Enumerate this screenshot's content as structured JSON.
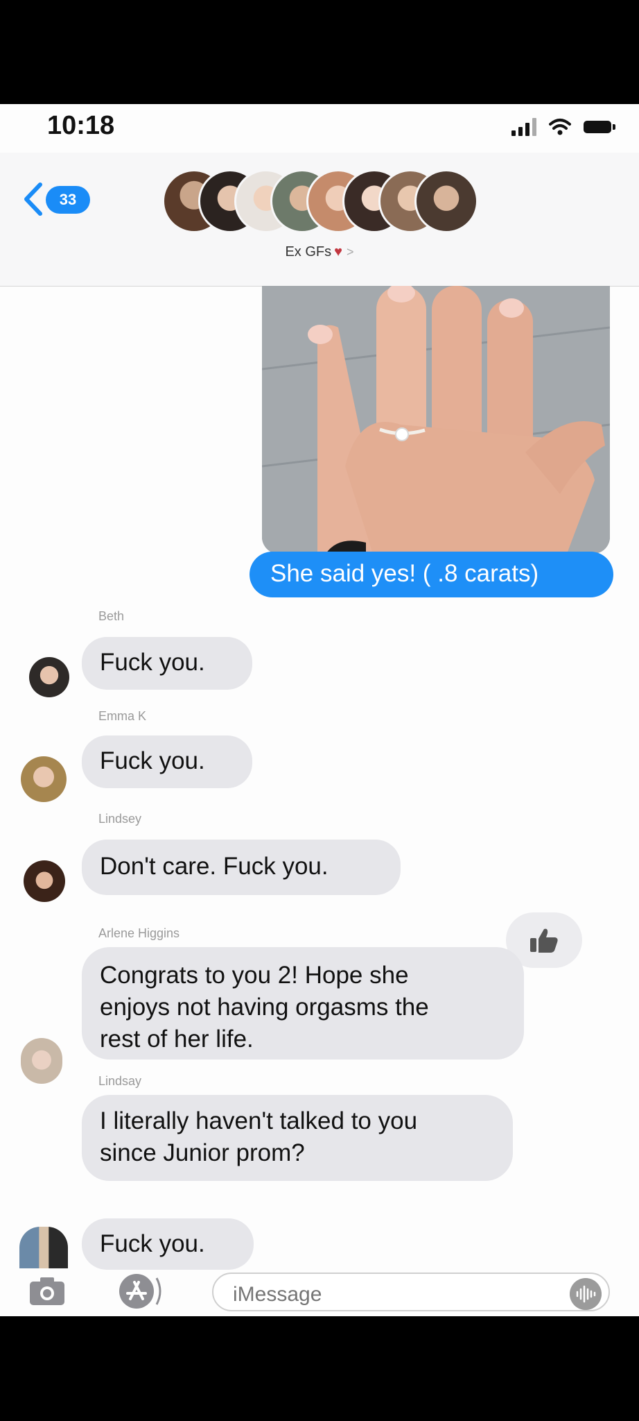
{
  "status_bar": {
    "time": "10:18"
  },
  "header": {
    "back_count": "33",
    "group_name": "Ex GFs"
  },
  "messages": [
    {
      "id": "m1",
      "direction": "outgoing",
      "text": "She said yes! ( .8 carats)"
    },
    {
      "id": "m2",
      "direction": "incoming",
      "sender": "Beth",
      "text": "Fuck you."
    },
    {
      "id": "m3",
      "direction": "incoming",
      "sender": "Emma K",
      "text": "Fuck you."
    },
    {
      "id": "m4",
      "direction": "incoming",
      "sender": "Lindsey",
      "text": "Don't care. Fuck you."
    },
    {
      "id": "m5",
      "direction": "incoming",
      "sender": "Arlene Higgins",
      "lines": [
        "Congrats to you 2! Hope she",
        "enjoys not having orgasms the",
        "rest of her life."
      ],
      "reaction": "thumbs-up-icon"
    },
    {
      "id": "m6",
      "direction": "incoming",
      "sender": "Lindsay",
      "lines": [
        "I literally haven't talked to you",
        "since Junior prom?"
      ]
    },
    {
      "id": "m7",
      "direction": "incoming",
      "text": "Fuck you."
    }
  ],
  "compose": {
    "placeholder": "iMessage"
  },
  "colors": {
    "outgoing_bubble": "#1e8ff7",
    "incoming_bubble": "#e6e6ea",
    "badge": "#1a8cf7"
  },
  "icons": [
    "back-chevron-icon",
    "camera-icon",
    "app-store-icon",
    "audio-wave-icon",
    "thumbs-up-icon",
    "heart-icon",
    "wifi-icon",
    "signal-icon",
    "battery-icon"
  ]
}
